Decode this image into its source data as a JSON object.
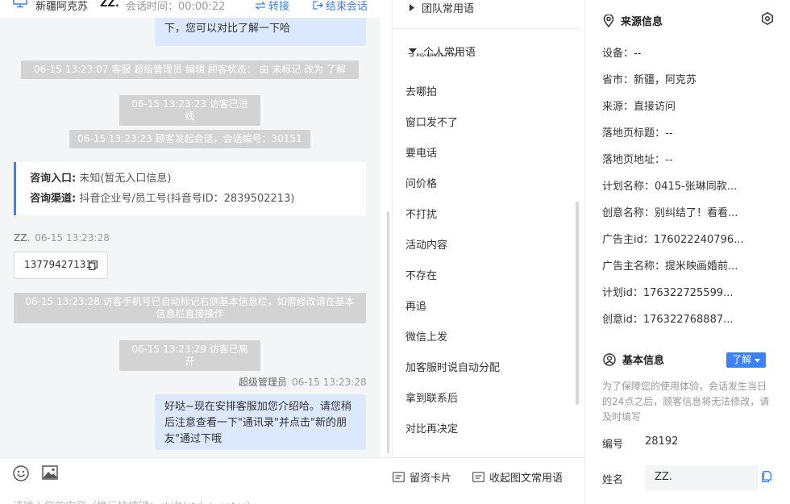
{
  "topbar": {
    "customer_region": "新疆阿克苏",
    "nickname": "ZZ.",
    "session_time": "会话时间：00:00:22",
    "transfer_label": "转接",
    "end_label": "结束会话"
  },
  "chat": {
    "top_bubble": "下，您可以对比了解一下哈",
    "sys1": "06-15 13:23:07 客服 超级管理员 编辑 顾客状态： 由 未标记 改为 了解",
    "sys2": "06-15 13:23:23 访客已进线",
    "sys3": "06-15 13:23:23 顾客发起会话，会话编号：30151",
    "entry_label": "咨询入口:",
    "entry_value": " 未知(暂无入口信息)",
    "channel_label": "咨询渠道:",
    "channel_value": " 抖音企业号/员工号(抖音号ID：2839502213)",
    "visitor_name": "ZZ.",
    "visitor_time": "06-15 13:23:28",
    "visitor_phone": "13779427131",
    "sys4": "06-15 13:23:28 访客手机号已自动标记右侧基本信息栏，如需修改请在基本信息栏直接操作",
    "sys5": "06-15 13:23:29 访客已离开",
    "agent_name": "超级管理员",
    "agent_time": "06-15 13:23:28",
    "agent_message": "好哒~现在安排客服加您介绍哈。请您稍后注意查看一下\"通讯录\"并点击\"新的朋友\"通过下哦"
  },
  "input": {
    "placeholder": "请输入您的内容（换行快捷键：shift/ctrl + enter）",
    "card_label": "留资卡片",
    "collapse_label": "收起图文常用语"
  },
  "phrases": {
    "team_group": "团队常用语",
    "personal_group": "个人常用语",
    "cut_item": "考虑旅拍吗?",
    "items": [
      "去哪拍",
      "窗口发不了",
      "要电话",
      "问价格",
      "不打扰",
      "活动内容",
      "不存在",
      "再追",
      "微信上发",
      "加客服时说自动分配",
      "拿到联系后",
      "对比再决定"
    ]
  },
  "info": {
    "source_title": "来源信息",
    "device": "设备：--",
    "province": "省市：新疆，阿克苏",
    "source": "来源：直接访问",
    "landing_title": "落地页标题：--",
    "landing_url": "落地页地址：--",
    "plan_name": "计划名称：0415-张琳同款...",
    "creative_name": "创意名称：别纠结了！看看...",
    "advertiser_id": "广告主id：176022240796...",
    "advertiser_name": "广告主名称：提米映画婚前...",
    "plan_id": "计划id：176322725599...",
    "creative_id": "创意id：176322768887...",
    "basic_title": "基本信息",
    "status_tag": "了解",
    "note": "为了保障您的使用体验，会话发生当日的24点之后，顾客信息将无法修改，请及时填写",
    "id_label": "编号",
    "id_value": "28192",
    "name_label": "姓名",
    "name_value": "ZZ."
  },
  "colors": {
    "accent": "#3b82f6",
    "bubble": "#dbe8fd",
    "system": "#d3d3d3",
    "chat_bg": "#f4f5f7"
  }
}
